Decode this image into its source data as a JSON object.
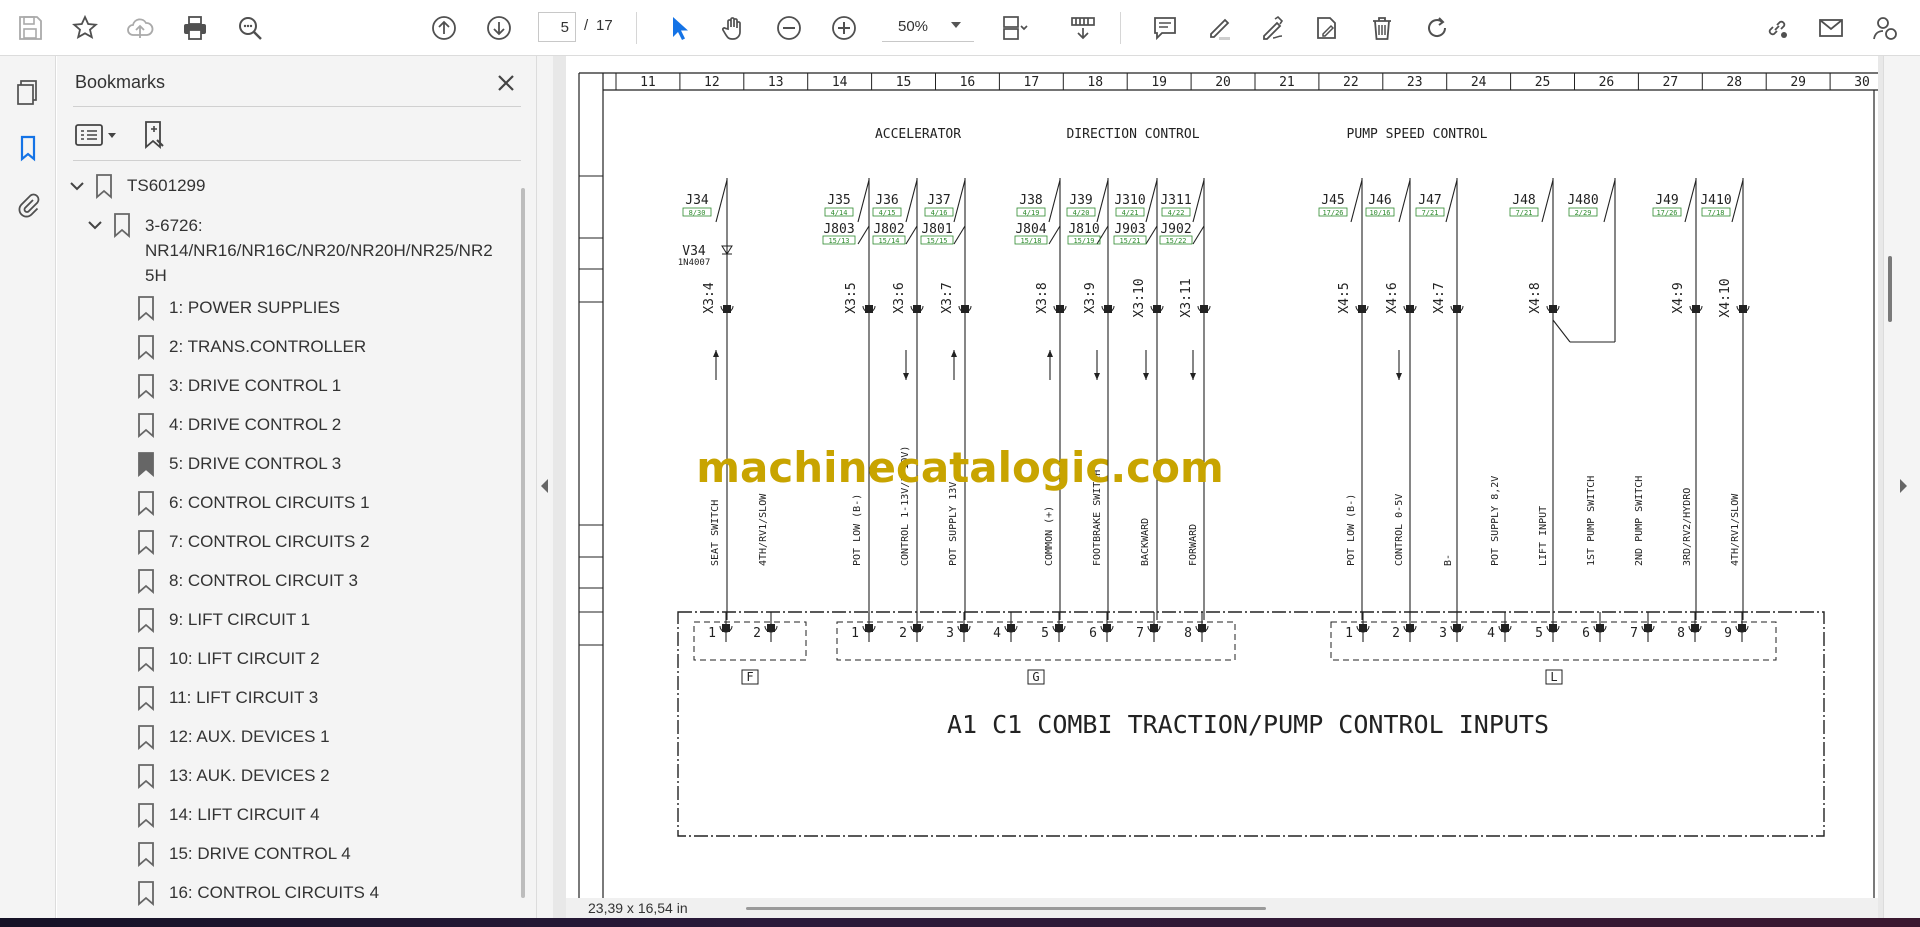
{
  "toolbar": {
    "current_page": "5",
    "page_separator": "/",
    "total_pages": "17",
    "zoom": "50%"
  },
  "bookmarks_panel": {
    "title": "Bookmarks",
    "root": "TS601299",
    "group": "3-6726: NR14/NR16/NR16C/NR20/NR20H/NR25/NR25H",
    "group_lines": [
      "3-6726:",
      "NR14/NR16/NR16C/NR20/NR20H/NR25/NR2",
      "5H"
    ],
    "items": [
      "1: POWER SUPPLIES",
      "2: TRANS.CONTROLLER",
      "3: DRIVE CONTROL 1",
      "4: DRIVE CONTROL 2",
      "5: DRIVE CONTROL 3",
      "6: CONTROL CIRCUITS 1",
      "7: CONTROL CIRCUITS 2",
      "8: CONTROL CIRCUIT 3",
      "9: LIFT CIRCUIT 1",
      "10: LIFT CIRCUIT 2",
      "11: LIFT CIRCUIT 3",
      "12: AUX. DEVICES 1",
      "13: AUK. DEVICES 2",
      "14: LIFT CIRCUIT 4",
      "15: DRIVE CONTROL 4",
      "16: CONTROL CIRCUITS 4"
    ]
  },
  "schematic": {
    "column_numbers": [
      "11",
      "12",
      "13",
      "14",
      "15",
      "16",
      "17",
      "18",
      "19",
      "20",
      "21",
      "22",
      "23",
      "24",
      "25",
      "26",
      "27",
      "28",
      "29",
      "30"
    ],
    "section_titles": [
      "ACCELERATOR",
      "DIRECTION CONTROL",
      "PUMP SPEED CONTROL"
    ],
    "top_jumpers": [
      {
        "name": "J34",
        "ref": "8/30"
      },
      {
        "name": "J35",
        "ref": "4/14"
      },
      {
        "name": "J36",
        "ref": "4/15"
      },
      {
        "name": "J37",
        "ref": "4/16"
      },
      {
        "name": "J38",
        "ref": "4/19"
      },
      {
        "name": "J39",
        "ref": "4/20"
      },
      {
        "name": "J310",
        "ref": "4/21"
      },
      {
        "name": "J311",
        "ref": "4/22"
      },
      {
        "name": "J45",
        "ref": "17/26"
      },
      {
        "name": "J46",
        "ref": "10/16"
      },
      {
        "name": "J47",
        "ref": "7/21"
      },
      {
        "name": "J48",
        "ref": "7/21"
      },
      {
        "name": "J480",
        "ref": "2/29"
      },
      {
        "name": "J49",
        "ref": "17/26"
      },
      {
        "name": "J410",
        "ref": "7/18"
      }
    ],
    "second_jumpers": [
      {
        "name": "J803",
        "ref": "15/13"
      },
      {
        "name": "J802",
        "ref": "15/14"
      },
      {
        "name": "J801",
        "ref": "15/15"
      },
      {
        "name": "J804",
        "ref": "15/18"
      },
      {
        "name": "J810",
        "ref": "15/19"
      },
      {
        "name": "J903",
        "ref": "15/21"
      },
      {
        "name": "J902",
        "ref": "15/22"
      }
    ],
    "diode": {
      "name": "V34",
      "part": "1N4007"
    },
    "connector_labels": [
      "X3:4",
      "X3:5",
      "X3:6",
      "X3:7",
      "X3:8",
      "X3:9",
      "X3:10",
      "X3:11",
      "X4:5",
      "X4:6",
      "X4:7",
      "X4:8",
      "X4:9",
      "X4:10"
    ],
    "signal_labels": [
      "SEAT SWITCH",
      "4TH/RV1/SLOW",
      "POT LOW (B-)",
      "CONTROL 1-13V/1-10V)",
      "POT SUPPLY 13V",
      "COMMON (+)",
      "FOOTBRAKE SWITCH",
      "BACKWARD",
      "FORWARD",
      "POT LOW (B-)",
      "CONTROL 0-5V",
      "B-",
      "POT SUPPLY 8,2V",
      "LIFT INPUT",
      "1ST PUMP SWITCH",
      "2ND PUMP SWITCH",
      "3RD/RV2/HYDRO",
      "4TH/RV1/SLOW"
    ],
    "group_labels": [
      "F",
      "G",
      "L"
    ],
    "pins_f": [
      "1",
      "2"
    ],
    "pins_g": [
      "1",
      "2",
      "3",
      "4",
      "5",
      "6",
      "7",
      "8"
    ],
    "pins_l": [
      "1",
      "2",
      "3",
      "4",
      "5",
      "6",
      "7",
      "8",
      "9"
    ],
    "box_title": "A1  C1 COMBI TRACTION/PUMP CONTROL INPUTS",
    "watermark": "machinecatalogic.com"
  },
  "status_bar": {
    "page_size": "23,39 x 16,54 in"
  },
  "colors": {
    "accent_blue": "#1473e6",
    "icon_gray": "#505050",
    "watermark": "#c8a400",
    "jumper_green": "#2e8b2e"
  }
}
